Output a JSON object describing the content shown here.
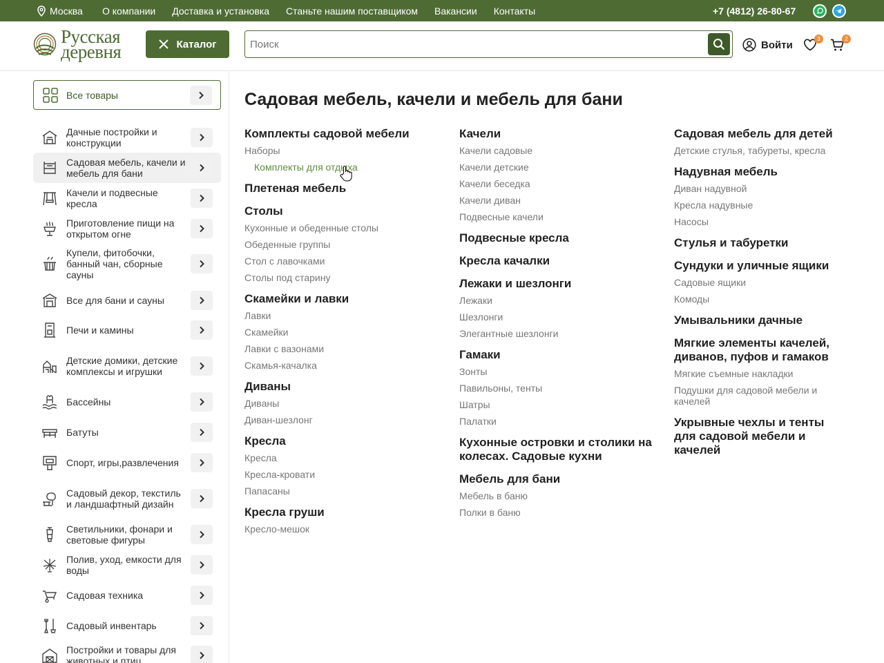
{
  "topbar": {
    "city": "Москва",
    "nav": [
      "О компании",
      "Доставка и установка",
      "Станьте нашим поставщиком",
      "Вакансии",
      "Контакты"
    ],
    "phone": "+7 (4812) 26-80-67"
  },
  "header": {
    "logo_line1": "Русская",
    "logo_line2": "деревня",
    "catalog_label": "Каталог",
    "search_placeholder": "Поиск",
    "login_label": "Войти",
    "favorites_count": "3",
    "cart_count": "2"
  },
  "sidebar": {
    "all_goods": "Все товары",
    "items": [
      {
        "label": "Дачные постройки и конструкции",
        "icon": "house-icon"
      },
      {
        "label": "Садовая мебель, качели и мебель для бани",
        "icon": "furniture-icon"
      },
      {
        "label": "Качели и подвесные кресла",
        "icon": "swing-icon"
      },
      {
        "label": "Приготовление пищи на открытом огне",
        "icon": "grill-icon"
      },
      {
        "label": "Купели, фитобочки, банный чан, сборные сауны",
        "icon": "tub-icon"
      },
      {
        "label": "Все для бани и сауны",
        "icon": "bathhouse-icon"
      },
      {
        "label": "Печи и камины",
        "icon": "stove-icon"
      },
      {
        "label": "Детские домики, детские комплексы и игрушки",
        "icon": "playhouse-icon"
      },
      {
        "label": "Бассейны",
        "icon": "pool-icon"
      },
      {
        "label": "Батуты",
        "icon": "trampoline-icon"
      },
      {
        "label": "Спорт, игры,развлечения",
        "icon": "sport-icon"
      },
      {
        "label": "Садовый декор, текстиль и ландшафтный дизайн",
        "icon": "decor-icon"
      },
      {
        "label": "Светильники, фонари и световые фигуры",
        "icon": "lantern-icon"
      },
      {
        "label": "Полив, уход, емкости для воды",
        "icon": "sprinkler-icon"
      },
      {
        "label": "Садовая техника",
        "icon": "wheelbarrow-icon"
      },
      {
        "label": "Садовый инвентарь",
        "icon": "tools-icon"
      },
      {
        "label": "Постройки и товары для животных и птиц",
        "icon": "barn-icon"
      }
    ]
  },
  "main": {
    "title": "Садовая мебель, качели и мебель для бани",
    "columns": [
      [
        {
          "title": "Комплекты садовой мебели",
          "items": [
            "Наборы"
          ],
          "indented": [
            "Комплекты для отдыха"
          ]
        },
        {
          "title": "Плетеная мебель",
          "items": []
        },
        {
          "title": "Столы",
          "items": [
            "Кухонные и обеденные столы",
            "Обеденные группы",
            "Стол с лавочками",
            "Столы под старину"
          ]
        },
        {
          "title": "Скамейки и лавки",
          "items": [
            "Лавки",
            "Скамейки",
            "Лавки с вазонами",
            "Скамья-качалка"
          ]
        },
        {
          "title": "Диваны",
          "items": [
            "Диваны",
            "Диван-шезлонг"
          ]
        },
        {
          "title": "Кресла",
          "items": [
            "Кресла",
            "Кресла-кровати",
            "Папасаны"
          ]
        },
        {
          "title": "Кресла груши",
          "items": [
            "Кресло-мешок"
          ]
        }
      ],
      [
        {
          "title": "Качели",
          "items": [
            "Качели садовые",
            "Качели детские",
            "Качели беседка",
            "Качели диван",
            "Подвесные качели"
          ]
        },
        {
          "title": "Подвесные кресла",
          "items": []
        },
        {
          "title": "Кресла качалки",
          "items": []
        },
        {
          "title": "Лежаки и шезлонги",
          "items": [
            "Лежаки",
            "Шезлонги",
            "Элегантные шезлонги"
          ]
        },
        {
          "title": "Гамаки",
          "items": [
            "Зонты",
            "Павильоны, тенты",
            "Шатры",
            "Палатки"
          ]
        },
        {
          "title": "Кухонные островки и столики на колесах. Садовые кухни",
          "items": []
        },
        {
          "title": "Мебель для бани",
          "items": [
            "Мебель в баню",
            "Полки в баню"
          ]
        }
      ],
      [
        {
          "title": "Садовая мебель для детей",
          "items": [
            "Детские стулья, табуреты, кресла"
          ]
        },
        {
          "title": "Надувная мебель",
          "items": [
            "Диван надувной",
            "Кресла надувные",
            "Насосы"
          ]
        },
        {
          "title": "Стулья и табуретки",
          "items": []
        },
        {
          "title": "Сундуки и уличные ящики",
          "items": [
            "Садовые ящики",
            "Комоды"
          ]
        },
        {
          "title": "Умывальники дачные",
          "items": []
        },
        {
          "title": "Мягкие элементы качелей, диванов, пуфов и гамаков",
          "items": [
            "Мягкие съемные накладки",
            "Подушки для садовой мебели и качелей"
          ]
        },
        {
          "title": "Укрывные чехлы и тенты для садовой мебели и качелей",
          "items": []
        }
      ]
    ]
  },
  "colors": {
    "brand": "#4e6b34",
    "accent": "#ec8f3c",
    "link_active": "#5e8e3e"
  }
}
